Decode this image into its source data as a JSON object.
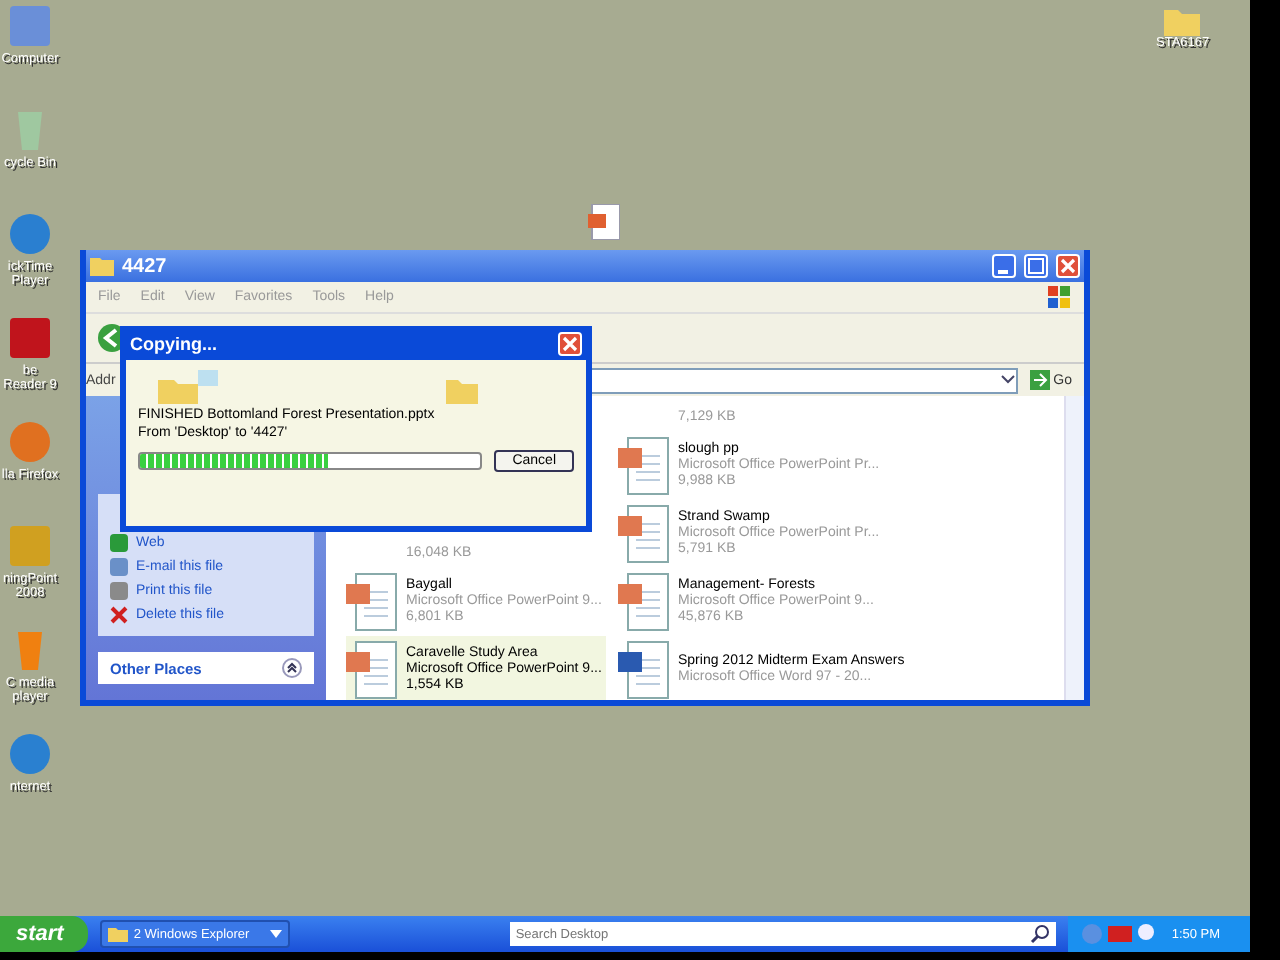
{
  "desktop_icons": [
    {
      "label": "Computer",
      "kind": "computer"
    },
    {
      "label": "cycle Bin",
      "kind": "bin"
    },
    {
      "label": "ickTime Player",
      "kind": "quicktime"
    },
    {
      "label": "be Reader 9",
      "kind": "pdf"
    },
    {
      "label": "lla Firefox",
      "kind": "firefox"
    },
    {
      "label": "ningPoint 2008",
      "kind": "turning"
    },
    {
      "label": "C media player",
      "kind": "vlc"
    },
    {
      "label": "nternet",
      "kind": "ie"
    }
  ],
  "desktop_folder": {
    "label": "STA6167"
  },
  "explorer": {
    "title": "4427",
    "menu": [
      "File",
      "Edit",
      "View",
      "Favorites",
      "Tools",
      "Help"
    ],
    "address_label": "Addr",
    "go": "Go",
    "tasks": [
      {
        "label": "Web",
        "kind": "web"
      },
      {
        "label": "E-mail this file",
        "kind": "email"
      },
      {
        "label": "Print this file",
        "kind": "print"
      },
      {
        "label": "Delete this file",
        "kind": "delete"
      }
    ],
    "other_places": "Other Places",
    "rows": [
      {
        "right": {
          "kind": "partial",
          "size": "7,129 KB",
          "selected": false
        }
      },
      {
        "right": {
          "kind": "ppt",
          "name": "slough pp",
          "type": "Microsoft Office PowerPoint Pr...",
          "size": "9,988 KB",
          "selected": false
        }
      },
      {
        "left": {
          "kind": "partial",
          "size": "16,048 KB",
          "selected": false
        },
        "right": {
          "kind": "ppt",
          "name": "Strand Swamp",
          "type": "Microsoft Office PowerPoint Pr...",
          "size": "5,791 KB",
          "selected": false
        }
      },
      {
        "left": {
          "kind": "ppt",
          "name": "Baygall",
          "type": "Microsoft Office PowerPoint 9...",
          "size": "6,801 KB",
          "selected": false
        },
        "right": {
          "kind": "ppt",
          "name": "Management- Forests",
          "type": "Microsoft Office PowerPoint 9...",
          "size": "45,876 KB",
          "selected": false
        }
      },
      {
        "left": {
          "kind": "ppt",
          "name": "Caravelle Study Area",
          "type": "Microsoft Office PowerPoint 9...",
          "size": "1,554 KB",
          "selected": true
        },
        "right": {
          "kind": "word",
          "name": "Spring 2012 Midterm Exam Answers",
          "type": "Microsoft Office Word 97 - 20...",
          "selected": false
        }
      }
    ]
  },
  "dialog": {
    "title": "Copying...",
    "message": "FINISHED Bottomland Forest Presentation.pptx",
    "route": "From 'Desktop' to '4427'",
    "level": 0.55,
    "cancel": "Cancel"
  },
  "taskbar": {
    "start": "start",
    "task": "2 Windows Explorer",
    "search_placeholder": "Search Desktop",
    "clock": "1:50 PM"
  }
}
